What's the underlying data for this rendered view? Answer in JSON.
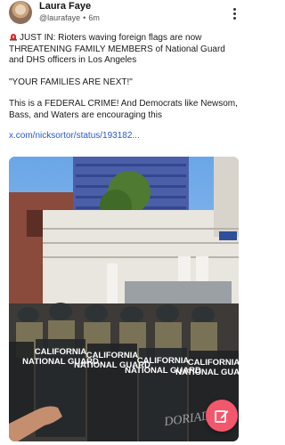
{
  "post": {
    "author": {
      "display_name": "Laura Faye",
      "handle": "@laurafaye",
      "time": "6m"
    },
    "alert_text": "JUST IN: Rioters waving foreign flags are now THREATENING FAMILY MEMBERS of National Guard and DHS officers in Los Angeles",
    "quote_text": "\"YOUR FAMILIES ARE NEXT!\"",
    "body_text": "This is a FEDERAL CRIME! And Democrats like Newsom, Bass, and Waters are encouraging this",
    "link_text": "x.com/nicksortor/status/193182..."
  },
  "media": {
    "shield_labels": [
      "CALIFORNIA NATIONAL GUARD",
      "CALIFORNIA NATIONAL GUARD",
      "CALIFORNIA NATIONAL GUARD",
      "CALIFORNIA NATIONAL GUARD"
    ],
    "watermark": "DORIADE"
  },
  "icons": {
    "siren": "siren-emoji-icon",
    "more": "more-vertical-icon",
    "compose": "compose-icon"
  },
  "colors": {
    "link": "#2b59c3",
    "fab": "#f2576c"
  }
}
